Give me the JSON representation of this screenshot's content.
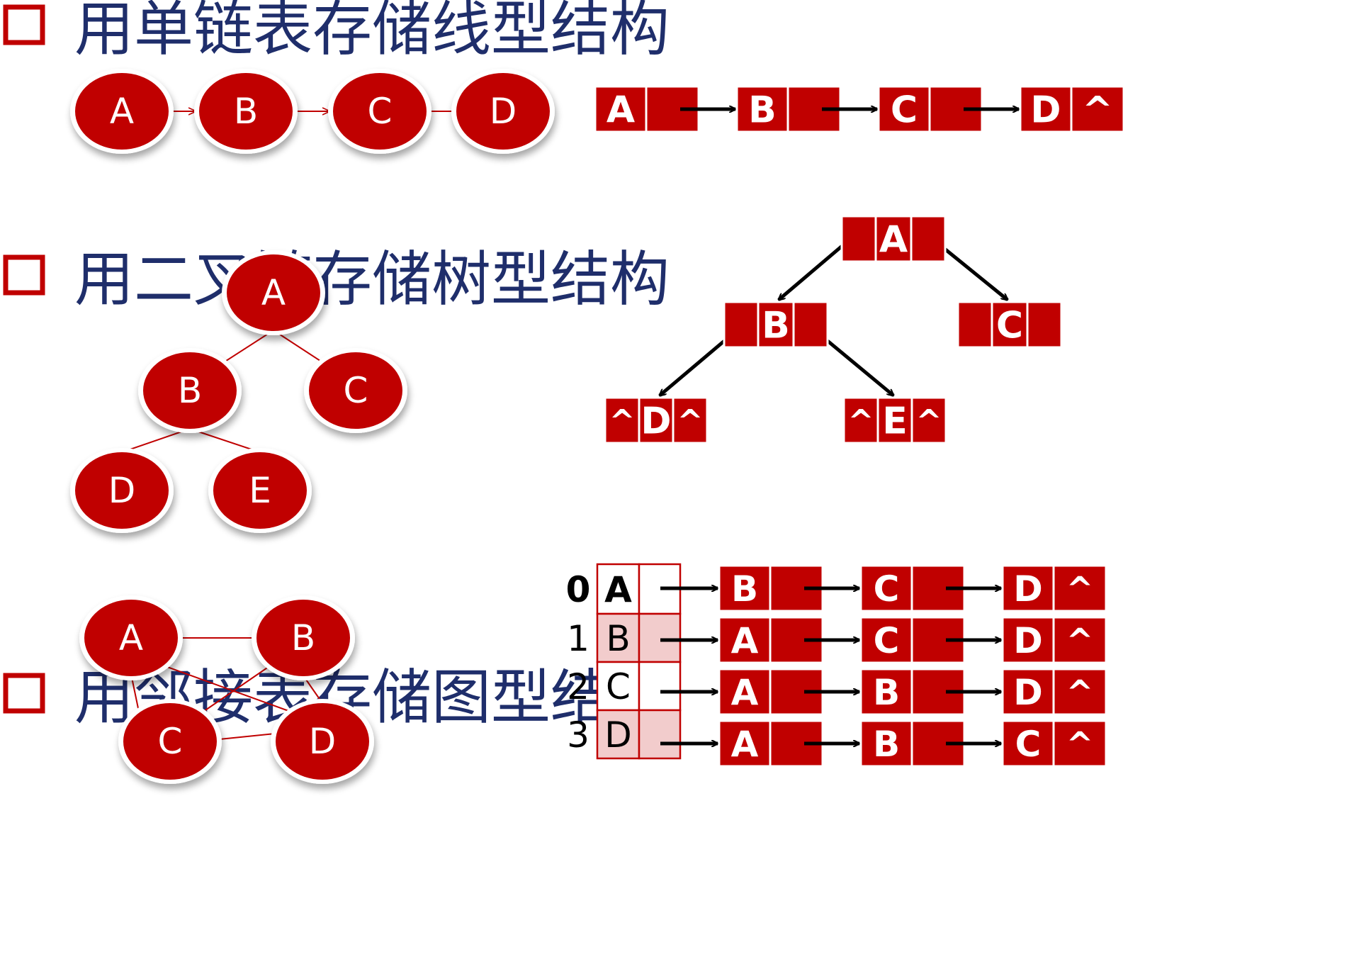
{
  "sections": [
    {
      "title": "用单链表存储线型结构"
    },
    {
      "title": "用二叉链存储树型结构"
    },
    {
      "title": "用邻接表存储图型结构"
    }
  ],
  "null_symbol": "^",
  "colors": {
    "node_red": "#c00000",
    "title_blue": "#1f2e6b",
    "table_pink": "#f2cccc",
    "edge_red": "#c00000",
    "arrow_black": "#000000"
  },
  "linear": {
    "logical_nodes": [
      "A",
      "B",
      "C",
      "D"
    ],
    "list_nodes": [
      {
        "data": "A",
        "next": ""
      },
      {
        "data": "B",
        "next": ""
      },
      {
        "data": "C",
        "next": ""
      },
      {
        "data": "D",
        "next": "^"
      }
    ]
  },
  "tree": {
    "logical_nodes": [
      "A",
      "B",
      "C",
      "D",
      "E"
    ],
    "logical_edges": [
      [
        "A",
        "B"
      ],
      [
        "A",
        "C"
      ],
      [
        "B",
        "D"
      ],
      [
        "B",
        "E"
      ]
    ],
    "binary_nodes": [
      {
        "id": "A",
        "left": "",
        "data": "A",
        "right": ""
      },
      {
        "id": "B",
        "left": "",
        "data": "B",
        "right": ""
      },
      {
        "id": "C",
        "left": "",
        "data": "C",
        "right": ""
      },
      {
        "id": "D",
        "left": "^",
        "data": "D",
        "right": "^"
      },
      {
        "id": "E",
        "left": "^",
        "data": "E",
        "right": "^"
      }
    ]
  },
  "graph": {
    "logical_nodes": [
      "A",
      "B",
      "C",
      "D"
    ],
    "logical_edges": [
      [
        "A",
        "B"
      ],
      [
        "A",
        "C"
      ],
      [
        "A",
        "D"
      ],
      [
        "B",
        "C"
      ],
      [
        "B",
        "D"
      ],
      [
        "C",
        "D"
      ]
    ],
    "table": [
      {
        "index": "0",
        "vertex": "A",
        "adj": [
          {
            "v": "B",
            "next": ""
          },
          {
            "v": "C",
            "next": ""
          },
          {
            "v": "D",
            "next": "^"
          }
        ]
      },
      {
        "index": "1",
        "vertex": "B",
        "adj": [
          {
            "v": "A",
            "next": ""
          },
          {
            "v": "C",
            "next": ""
          },
          {
            "v": "D",
            "next": "^"
          }
        ]
      },
      {
        "index": "2",
        "vertex": "C",
        "adj": [
          {
            "v": "A",
            "next": ""
          },
          {
            "v": "B",
            "next": ""
          },
          {
            "v": "D",
            "next": "^"
          }
        ]
      },
      {
        "index": "3",
        "vertex": "D",
        "adj": [
          {
            "v": "A",
            "next": ""
          },
          {
            "v": "B",
            "next": ""
          },
          {
            "v": "C",
            "next": "^"
          }
        ]
      }
    ]
  }
}
